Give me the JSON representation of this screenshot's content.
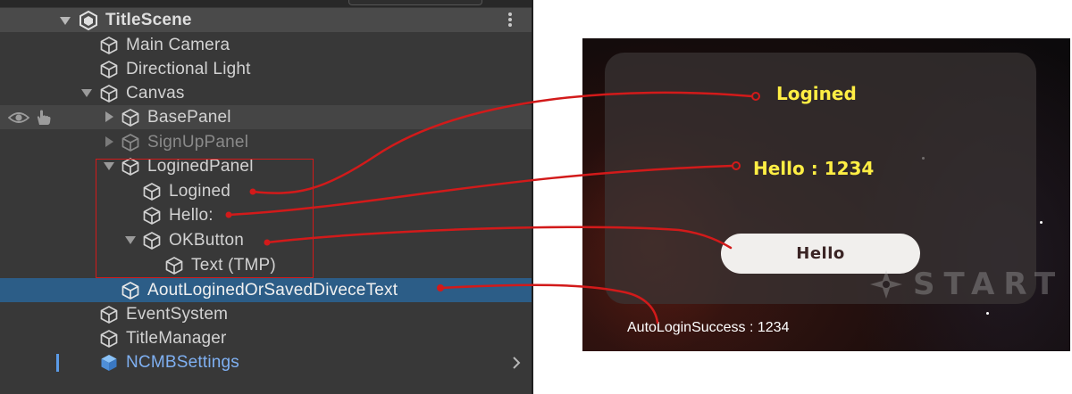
{
  "hierarchy": {
    "scene": {
      "label": "TitleScene",
      "menu_icon": "kebab-menu-icon"
    },
    "items": [
      {
        "label": "Main Camera"
      },
      {
        "label": "Directional Light"
      },
      {
        "label": "Canvas"
      },
      {
        "label": "BasePanel"
      },
      {
        "label": "SignUpPanel"
      },
      {
        "label": "LoginedPanel"
      },
      {
        "label": "Logined"
      },
      {
        "label": "Hello:"
      },
      {
        "label": "OKButton"
      },
      {
        "label": "Text (TMP)"
      },
      {
        "label": "AoutLoginedOrSavedDiveceText"
      },
      {
        "label": "EventSystem"
      },
      {
        "label": "TitleManager"
      },
      {
        "label": "NCMBSettings"
      }
    ]
  },
  "game": {
    "logined_text": "Logined",
    "hello_text": "Hello : 1234",
    "button_label": "Hello",
    "logo_text": "START",
    "auto_login_text": "AutoLoginSuccess : 1234"
  },
  "colors": {
    "hierarchy_bg": "#383838",
    "selection": "#2c5d87",
    "prefab_blue": "#7fb0f2",
    "annotation_red": "#d21a1a",
    "game_text_yellow": "#ffee44"
  }
}
